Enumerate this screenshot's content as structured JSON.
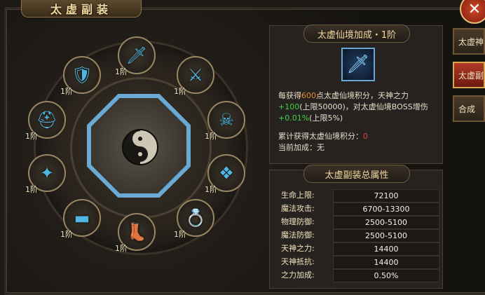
{
  "window": {
    "title": "太虚副装"
  },
  "tabs": [
    {
      "label": "太虚神",
      "active": false
    },
    {
      "label": "太虚副",
      "active": true
    },
    {
      "label": "合成",
      "active": false
    }
  ],
  "slots": [
    {
      "name": "sword",
      "level": "1阶",
      "icon": "sword-icon"
    },
    {
      "name": "bracer-top-right",
      "level": "1阶",
      "icon": "bracer-icon"
    },
    {
      "name": "armor-top-left",
      "level": "1阶",
      "icon": "armor-icon"
    },
    {
      "name": "helmet-left",
      "level": "1阶",
      "icon": "helmet-icon"
    },
    {
      "name": "mask-right",
      "level": "1阶",
      "icon": "mask-icon"
    },
    {
      "name": "necklace-left",
      "level": "1阶",
      "icon": "necklace-icon"
    },
    {
      "name": "amulet-right",
      "level": "1阶",
      "icon": "amulet-icon"
    },
    {
      "name": "belt-bottom-left",
      "level": "1阶",
      "icon": "belt-icon"
    },
    {
      "name": "boots-bottom",
      "level": "1阶",
      "icon": "boots-icon"
    },
    {
      "name": "ring-bottom-right",
      "level": "1阶",
      "icon": "ring-icon"
    }
  ],
  "info": {
    "header": "太虚仙境加成・1阶",
    "item_icon": "sword-icon",
    "desc_prefix": "每获得",
    "desc_points": "600",
    "desc_middle": "点太虚仙境积分，天神之力",
    "desc_power": "+100",
    "desc_limit": "(上限50000)，对太虚仙境BOSS增伤",
    "desc_boss": "+0.01%",
    "desc_tail": "(上限5%)",
    "accum_label": "累计获得太虚仙境积分：",
    "accum_value": "0",
    "current_label": "当前加成：",
    "current_value": "无"
  },
  "attrs": {
    "header": "太虚副装总属性",
    "rows": [
      {
        "label": "生命上限:",
        "value": "72100"
      },
      {
        "label": "魔法攻击:",
        "value": "6700-13300"
      },
      {
        "label": "物理防御:",
        "value": "2500-5100"
      },
      {
        "label": "魔法防御:",
        "value": "2500-5100"
      },
      {
        "label": "天神之力:",
        "value": "14400"
      },
      {
        "label": "天神抵抗:",
        "value": "14400"
      },
      {
        "label": "之力加成:",
        "value": "0.50%"
      }
    ]
  },
  "colors": {
    "accent_blue": "#6aa9d4",
    "gold": "#f2d9a0",
    "green": "#3fd03f",
    "orange": "#e38b2b",
    "red": "#e23f3f"
  }
}
